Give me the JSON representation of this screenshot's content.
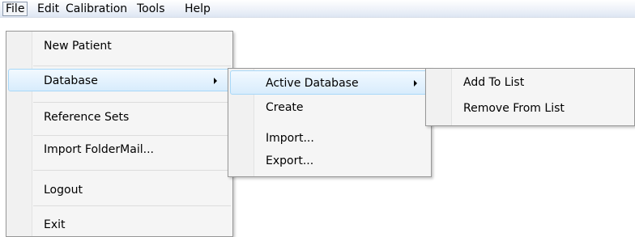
{
  "menubar": {
    "items": [
      {
        "label": "File"
      },
      {
        "label": "Edit"
      },
      {
        "label": "Calibration"
      },
      {
        "label": "Tools"
      },
      {
        "label": "Help"
      }
    ]
  },
  "file_menu": {
    "items": [
      {
        "label": "New Patient"
      },
      {
        "label": "Database"
      },
      {
        "label": "Reference Sets"
      },
      {
        "label": "Import FolderMail..."
      },
      {
        "label": "Logout"
      },
      {
        "label": "Exit"
      }
    ]
  },
  "database_menu": {
    "items": [
      {
        "label": "Active Database"
      },
      {
        "label": "Create"
      },
      {
        "label": "Import..."
      },
      {
        "label": "Export..."
      }
    ]
  },
  "active_database_menu": {
    "items": [
      {
        "label": "Add To List"
      },
      {
        "label": "Remove From List"
      }
    ]
  }
}
